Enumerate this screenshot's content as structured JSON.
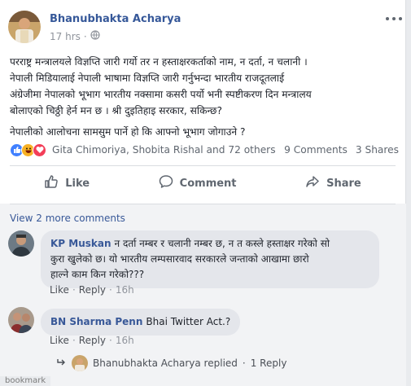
{
  "post": {
    "author": "Bhanubhakta Acharya",
    "time": "17 hrs",
    "privacy_icon": "globe-icon",
    "lines": [
      "परराष्ट्र मन्त्रालयले विज्ञप्ति जारी गर्यो तर न हस्ताक्षरकर्ताको नाम, न दर्ता, न चलानी ।",
      "नेपाली मिडियालाई नेपाली भाषामा विज्ञप्ति जारी गर्नुभन्दा भारतीय राजदूतलाई",
      "अंग्रेजीमा नेपालको भूभाग भारतीय नक्सामा कसरी पर्यो भनी स्पष्टीकरण दिन मन्त्रालय",
      "बोलाएको चिठ्ठी हेर्न मन छ । श्री दुइतिहाइ सरकार, सकिन्छ?"
    ],
    "line2": "नेपालीको आलोचना सामसुम पार्ने हो कि आफ्नो भूभाग जोगाउने ?"
  },
  "reactions": {
    "names": "Gita Chimoriya, Shobita Rishal and 72 others",
    "comments_count": "9 Comments",
    "shares_count": "3 Shares",
    "colors": {
      "like": "#4080ff",
      "haha": "#f7b125",
      "love": "#f33e58"
    }
  },
  "actions": {
    "like": "Like",
    "comment": "Comment",
    "share": "Share"
  },
  "view_more": "View 2 more comments",
  "comments": [
    {
      "name": "KP Muskan",
      "text_lines": [
        "न दर्ता नम्बर र चलानी नम्बर छ, न त कस्ले हस्ताक्षर गरेको सो",
        "कुरा खुलेको छ। यो भारतीय लम्पसारवाद सरकारले जन्ताको आखामा छारो",
        "हाल्ने काम किन गरेको???"
      ],
      "like": "Like",
      "reply": "Reply",
      "time": "16h"
    },
    {
      "name": "BN Sharma Penn",
      "text": "Bhai Twitter Act.?",
      "like": "Like",
      "reply": "Reply",
      "time": "16h"
    }
  ],
  "replied": {
    "text": "Bhanubhakta Acharya replied",
    "sep": "·",
    "count": "1 Reply"
  },
  "bottom_tag": "bookmark"
}
